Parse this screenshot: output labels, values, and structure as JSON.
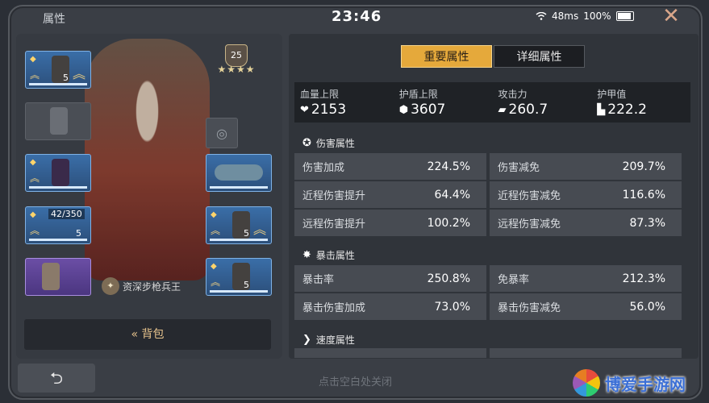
{
  "header": {
    "title": "属性",
    "clock": "23:46",
    "ping": "48ms",
    "battery": "100%"
  },
  "character": {
    "level": "25",
    "stars": "★★★★",
    "rank": "资深步枪兵王",
    "durability": "42/350",
    "slot_levels": [
      "5",
      "5",
      "5",
      "5"
    ]
  },
  "bag_button": "« 背包",
  "back_button": "⮌",
  "hint": "点击空白处关闭",
  "watermark": "博爱手游网",
  "tabs": {
    "active": "重要属性",
    "inactive": "详细属性"
  },
  "top_stats": [
    {
      "label": "血量上限",
      "value": "2153",
      "icon": "heart-icon"
    },
    {
      "label": "护盾上限",
      "value": "3607",
      "icon": "shield-icon"
    },
    {
      "label": "攻击力",
      "value": "260.7",
      "icon": "gun-icon"
    },
    {
      "label": "护甲值",
      "value": "222.2",
      "icon": "armor-icon"
    }
  ],
  "sections": {
    "damage": {
      "title": "伤害属性",
      "rows": [
        [
          {
            "label": "伤害加成",
            "value": "224.5%"
          },
          {
            "label": "伤害减免",
            "value": "209.7%"
          }
        ],
        [
          {
            "label": "近程伤害提升",
            "value": "64.4%"
          },
          {
            "label": "近程伤害减免",
            "value": "116.6%"
          }
        ],
        [
          {
            "label": "远程伤害提升",
            "value": "100.2%"
          },
          {
            "label": "远程伤害减免",
            "value": "87.3%"
          }
        ]
      ]
    },
    "crit": {
      "title": "暴击属性",
      "rows": [
        [
          {
            "label": "暴击率",
            "value": "250.8%"
          },
          {
            "label": "免暴率",
            "value": "212.3%"
          }
        ],
        [
          {
            "label": "暴击伤害加成",
            "value": "73.0%"
          },
          {
            "label": "暴击伤害减免",
            "value": "56.0%"
          }
        ]
      ]
    },
    "speed": {
      "title": "速度属性"
    }
  }
}
